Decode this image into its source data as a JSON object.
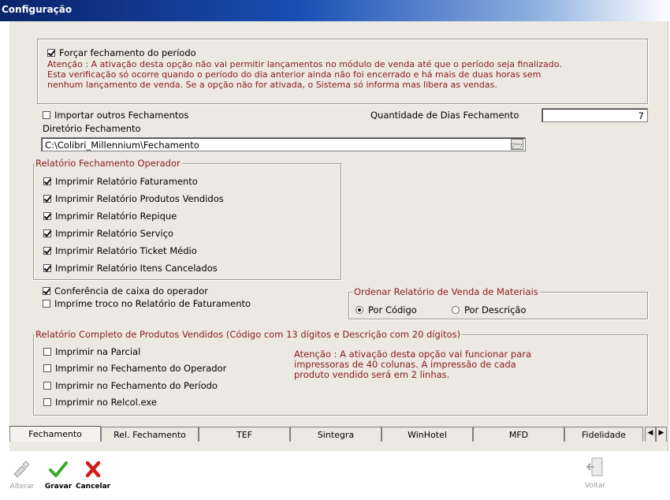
{
  "window": {
    "title": "Configuração"
  },
  "top_section": {
    "force_close_label": "Forçar fechamento do período",
    "force_close_checked": true,
    "warning_lines": [
      "Atenção : A ativação desta opção não vai permitir lançamentos no módulo de venda até que o período seja finalizado.",
      "Esta verificação só ocorre quando o período do dia anterior ainda não foi encerrado e há mais de duas horas sem",
      "nenhum lançamento de venda. Se a opção não for ativada, o Sistema só informa mas libera as vendas."
    ]
  },
  "import_label": "Importar outros Fechamentos",
  "directory": {
    "label": "Diretório Fechamento",
    "value": "C:\\Colibri_Millennium\\Fechamento"
  },
  "days": {
    "label": "Quantidade de Dias Fechamento",
    "value": "7"
  },
  "operator_report": {
    "title": "Relatório Fechamento Operador",
    "items": [
      {
        "label": "Imprimir Relatório Faturamento",
        "checked": true
      },
      {
        "label": "Imprimir Relatório Produtos Vendidos",
        "checked": true
      },
      {
        "label": "Imprimir Relatório Repique",
        "checked": true
      },
      {
        "label": "Imprimir Relatório Serviço",
        "checked": true
      },
      {
        "label": "Imprimir Relatório Ticket Médio",
        "checked": true
      },
      {
        "label": "Imprimir Relatório Itens Cancelados",
        "checked": true
      }
    ]
  },
  "conference_label": "Conferência de caixa do operador",
  "troco_label": "Imprime troco no Relatório de Faturamento",
  "order_report": {
    "title": "Ordenar Relatório de Venda de Materiais",
    "by_code": "Por Código",
    "by_description": "Por Descrição",
    "selected": "Por Código"
  },
  "complete_report": {
    "title": "Relatório Completo de Produtos Vendidos (Código com 13 dígitos e Descrição com 20 dígitos)",
    "items": [
      {
        "label": "Imprimir na Parcial",
        "checked": false
      },
      {
        "label": "Imprimir no Fechamento do Operador",
        "checked": false
      },
      {
        "label": "Imprimir no Fechamento do Período",
        "checked": false
      },
      {
        "label": "Imprimir no Relcol.exe",
        "checked": false
      }
    ],
    "warning_lines": [
      "Atenção : A ativação desta opção vai funcionar para",
      "impressoras de 40 colunas. A impressão de cada",
      "produto vendido será em 2 linhas."
    ]
  },
  "tabs": [
    "Fechamento",
    "Rel. Fechamento",
    "TEF",
    "Sintegra",
    "WinHotel",
    "MFD",
    "Fidelidade"
  ],
  "active_tab": "Fechamento",
  "toolbar": {
    "alterar": "Alterar",
    "gravar": "Gravar",
    "cancelar": "Cancelar",
    "voltar": "Voltar"
  },
  "colors": {
    "title_bar": "#0a246a",
    "warning_text": "#8b1a1a",
    "panel_bg": "#ece9e3",
    "save_green": "#3aa82c",
    "cancel_red": "#d21c1c"
  }
}
